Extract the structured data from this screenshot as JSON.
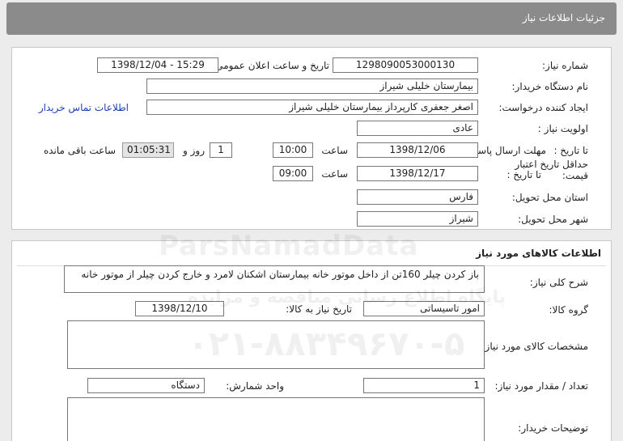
{
  "header": {
    "title": "جزئیات اطلاعات نیاز"
  },
  "need_info": {
    "need_number_label": "شماره نیاز:",
    "need_number": "1298090053000130",
    "announce_label": "تاریخ و ساعت اعلان عمومی:",
    "announce_value": "1398/12/04 - 15:29",
    "buyer_org_label": "نام دستگاه خریدار:",
    "buyer_org": "بیمارستان خلیلی شیراز",
    "requester_label": "ایجاد کننده درخواست:",
    "requester": "اصغر جعفری کارپرداز بیمارستان خلیلی شیراز",
    "contact_link": "اطلاعات تماس خریدار",
    "priority_label": "اولویت نیاز :",
    "priority": "عادی",
    "send_deadline_label": "مهلت ارسال پاسخ:",
    "to_date_label": "تا تاریخ :",
    "send_date": "1398/12/06",
    "time_label": "ساعت",
    "send_time": "10:00",
    "days_value": "1",
    "days_and_label": "روز و",
    "remaining_time": "01:05:31",
    "remaining_label": "ساعت باقی مانده",
    "validity_label": "حداقل تاریخ اعتبار قیمت:",
    "validity_to_label": "تا تاریخ :",
    "validity_date": "1398/12/17",
    "validity_time_label": "ساعت",
    "validity_time": "09:00",
    "province_label": "استان محل تحویل:",
    "province": "فارس",
    "city_label": "شهر محل تحویل:",
    "city": "شیراز"
  },
  "goods": {
    "section_title": "اطلاعات کالاهای مورد نیاز",
    "summary_label": "شرح کلی نیاز:",
    "summary": "باز کردن چیلر 160تن از داخل موتور خانه بیمارستان اشکنان لامرد و خارج کردن چیلر از موتور خانه",
    "group_label": "گروه کالا:",
    "group": "امور تاسیساتی",
    "need_date_label": "تاریخ نیاز به کالا:",
    "need_date": "1398/12/10",
    "specs_label": "مشخصات کالای مورد نیاز:",
    "specs": "",
    "qty_label": "تعداد / مقدار مورد نیاز:",
    "qty": "1",
    "unit_label": "واحد شمارش:",
    "unit": "دستگاه",
    "buyer_notes_label": "توضیحات خریدار:",
    "buyer_notes": ""
  },
  "watermark": {
    "brand": "ParsNamadData",
    "line1": "پایگاه اطلاع رسانی مناقصه و مزایده",
    "phone": "۰۲۱-۸۸۳۴۹۶۷۰-۵"
  }
}
